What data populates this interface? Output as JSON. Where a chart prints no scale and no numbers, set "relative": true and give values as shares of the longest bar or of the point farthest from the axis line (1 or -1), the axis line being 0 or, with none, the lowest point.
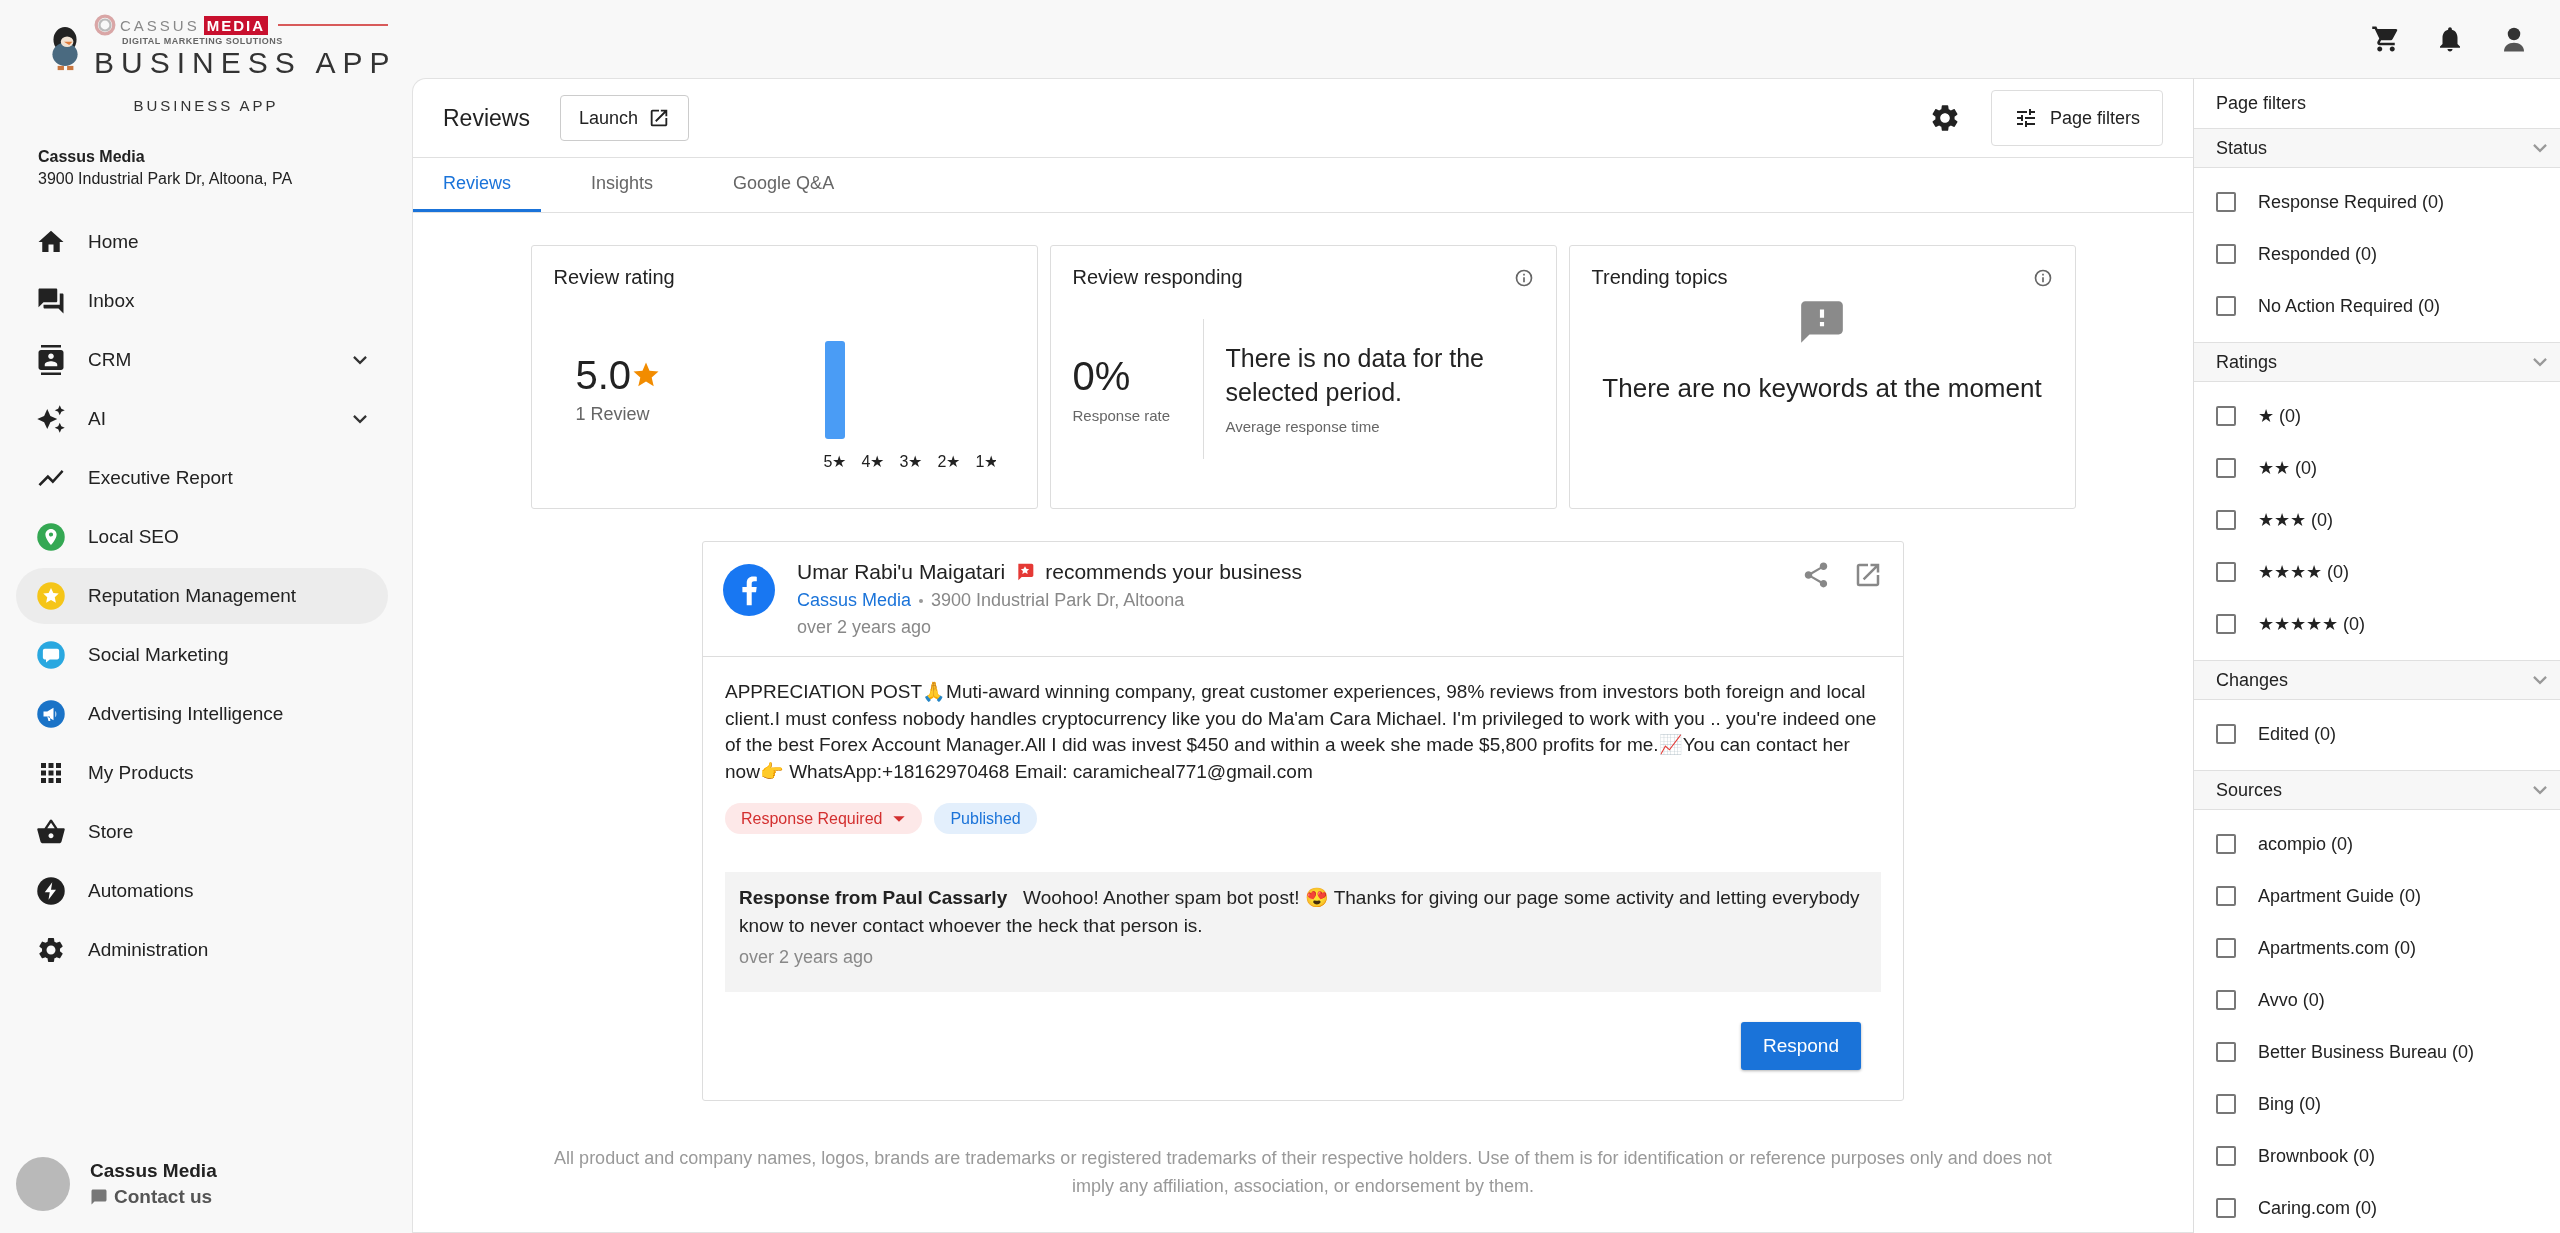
{
  "logo": {
    "brand": "CASSUS",
    "brand_highlight": "MEDIA",
    "tagline": "DIGITAL MARKETING SOLUTIONS",
    "product": "BUSINESS APP"
  },
  "app_name": "BUSINESS APP",
  "account": {
    "name": "Cassus Media",
    "address": "3900 Industrial Park Dr, Altoona, PA"
  },
  "nav": [
    {
      "label": "Home",
      "selected": false,
      "expandable": false
    },
    {
      "label": "Inbox",
      "selected": false,
      "expandable": false
    },
    {
      "label": "CRM",
      "selected": false,
      "expandable": true
    },
    {
      "label": "AI",
      "selected": false,
      "expandable": true
    },
    {
      "label": "Executive Report",
      "selected": false,
      "expandable": false
    },
    {
      "label": "Local SEO",
      "selected": false,
      "expandable": false
    },
    {
      "label": "Reputation Management",
      "selected": true,
      "expandable": false
    },
    {
      "label": "Social Marketing",
      "selected": false,
      "expandable": false
    },
    {
      "label": "Advertising Intelligence",
      "selected": false,
      "expandable": false
    },
    {
      "label": "My Products",
      "selected": false,
      "expandable": false
    },
    {
      "label": "Store",
      "selected": false,
      "expandable": false
    },
    {
      "label": "Automations",
      "selected": false,
      "expandable": false
    },
    {
      "label": "Administration",
      "selected": false,
      "expandable": false
    }
  ],
  "profile": {
    "name": "Cassus Media",
    "contact": "Contact us"
  },
  "header": {
    "title": "Reviews",
    "launch": "Launch",
    "page_filters": "Page filters"
  },
  "tabs": [
    {
      "label": "Reviews",
      "selected": true
    },
    {
      "label": "Insights",
      "selected": false
    },
    {
      "label": "Google Q&A",
      "selected": false
    }
  ],
  "summary": {
    "rating": {
      "title": "Review rating",
      "score": "5.0",
      "count": "1 Review",
      "chart_data": {
        "type": "bar",
        "relative": true,
        "categories": [
          "5★",
          "4★",
          "3★",
          "2★",
          "1★"
        ],
        "values": [
          1,
          0,
          0,
          0,
          0
        ]
      }
    },
    "responding": {
      "title": "Review responding",
      "rate": "0%",
      "rate_label": "Response rate",
      "no_data": "There is no data for the selected period.",
      "time_label": "Average response time"
    },
    "topics": {
      "title": "Trending topics",
      "empty": "There are no keywords at the moment"
    }
  },
  "review": {
    "author": "Umar Rabi'u Maigatari",
    "action": "recommends your business",
    "business": "Cassus Media",
    "location": "3900 Industrial Park Dr, Altoona",
    "time": "over 2 years ago",
    "body": "APPRECIATION POST🙏Muti-award winning company, great customer experiences, 98% reviews from investors both foreign and local client.I must confess nobody handles cryptocurrency like you do Ma'am Cara Michael. I'm privileged to work with you .. you're indeed one of the best Forex Account Manager.All I did was invest $450 and within a week she made $5,800 profits for me.📈You can contact her now👉 WhatsApp:+18162970468 Email: caramicheal771@gmail.com",
    "status": "Response Required",
    "published": "Published",
    "response": {
      "label": "Response from Paul Cassarly",
      "text": "Woohoo! Another spam bot post! 😍 Thanks for giving our page some activity and letting everybody know to never contact whoever the heck that person is.",
      "time": "over 2 years ago"
    },
    "respond": "Respond"
  },
  "footer": "All product and company names, logos, brands are trademarks or registered trademarks of their respective holders. Use of them is for identification or reference purposes only and does not imply any affiliation, association, or endorsement by them.",
  "filters": {
    "title": "Page filters",
    "sections": [
      {
        "title": "Status",
        "expanded": true,
        "options": [
          {
            "label": "Response Required (0)",
            "checked": false
          },
          {
            "label": "Responded (0)",
            "checked": false
          },
          {
            "label": "No Action Required (0)",
            "checked": false
          }
        ]
      },
      {
        "title": "Ratings",
        "expanded": true,
        "options": [
          {
            "label": "★ (0)",
            "checked": false
          },
          {
            "label": "★★ (0)",
            "checked": false
          },
          {
            "label": "★★★ (0)",
            "checked": false
          },
          {
            "label": "★★★★ (0)",
            "checked": false
          },
          {
            "label": "★★★★★ (0)",
            "checked": false
          }
        ]
      },
      {
        "title": "Changes",
        "expanded": true,
        "options": [
          {
            "label": "Edited (0)",
            "checked": false
          }
        ]
      },
      {
        "title": "Sources",
        "expanded": true,
        "options": [
          {
            "label": "acompio (0)",
            "checked": false
          },
          {
            "label": "Apartment Guide (0)",
            "checked": false
          },
          {
            "label": "Apartments.com (0)",
            "checked": false
          },
          {
            "label": "Avvo (0)",
            "checked": false
          },
          {
            "label": "Better Business Bureau (0)",
            "checked": false
          },
          {
            "label": "Bing (0)",
            "checked": false
          },
          {
            "label": "Brownbook (0)",
            "checked": false
          },
          {
            "label": "Caring.com (0)",
            "checked": false
          }
        ]
      }
    ]
  }
}
